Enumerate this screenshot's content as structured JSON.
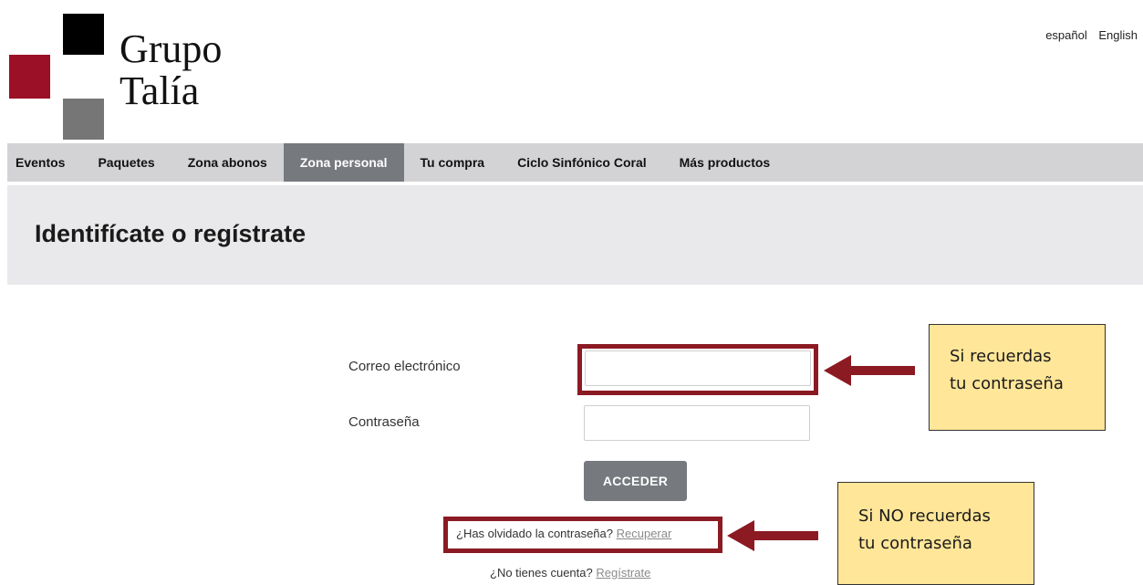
{
  "brand": {
    "line1": "Grupo",
    "line2": "Talía"
  },
  "language": {
    "es": "español",
    "en": "English"
  },
  "nav": {
    "items": [
      "Eventos",
      "Paquetes",
      "Zona abonos",
      "Zona personal",
      "Tu compra",
      "Ciclo Sinfónico Coral",
      "Más productos"
    ],
    "active": "Zona personal"
  },
  "page": {
    "title": "Identifícate o regístrate"
  },
  "form": {
    "email_label": "Correo electrónico",
    "email_value": "",
    "password_label": "Contraseña",
    "password_value": "",
    "submit_label": "ACCEDER",
    "forgot_text": "¿Has olvidado la contraseña?",
    "forgot_link": "Recuperar",
    "register_text": "¿No tienes cuenta?",
    "register_link": "Regístrate"
  },
  "annotations": {
    "note1": {
      "line1": "Si recuerdas",
      "line2": "tu contraseña"
    },
    "note2": {
      "line1": "Si NO recuerdas",
      "line2": "tu contraseña"
    }
  },
  "colors": {
    "brand_red": "#9b1027",
    "highlight": "#8b1a23",
    "note_bg": "#ffe699",
    "nav_bg": "#d3d3d6",
    "nav_active": "#76797e"
  }
}
